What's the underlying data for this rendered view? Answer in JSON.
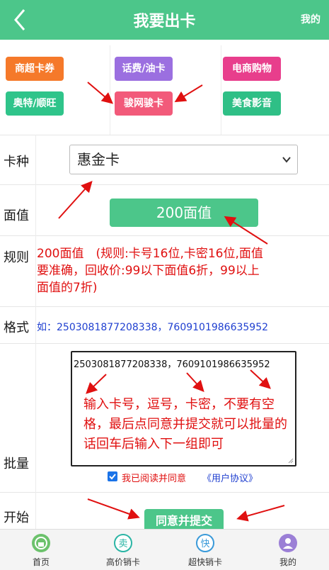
{
  "header": {
    "title": "我要出卡",
    "mine_label": "我的"
  },
  "categories": [
    {
      "label": "商超卡券",
      "color": "#f5792a"
    },
    {
      "label": "话费/油卡",
      "color": "#9b6fe0"
    },
    {
      "label": "电商购物",
      "color": "#e83e8c"
    },
    {
      "label": "奥特/顺旺",
      "color": "#2fc48a"
    },
    {
      "label": "骏网骏卡",
      "color": "#f25a7a"
    },
    {
      "label": "美食影音",
      "color": "#2fbf86"
    }
  ],
  "form": {
    "card_type_label": "卡种",
    "card_type_value": "惠金卡",
    "face_label": "面值",
    "face_value": "200面值",
    "rule_label": "规则",
    "rule_text": "200面值　(规则:卡号16位,卡密16位,面值要准确，回收价:99以下面值6折，99以上面值的7折)",
    "format_label": "格式",
    "format_text": "如：2503081877208338，7609101986635952",
    "batch_label": "批量",
    "batch_value": "2503081877208338，7609101986635952",
    "batch_hint": "输入卡号，逗号，卡密，不要有空格，最后点同意并提交就可以批量的话回车后输入下一组即可",
    "agree_text": "我已阅读并同意",
    "agree_link": "《用户协议》",
    "agree_checked": true,
    "start_label": "开始",
    "submit_label": "同意并提交"
  },
  "tabbar": [
    {
      "label": "首页",
      "icon": "home-icon",
      "color": "#6cc26c"
    },
    {
      "label": "高价销卡",
      "icon": "sell-icon",
      "color": "#2bb5a5"
    },
    {
      "label": "超快销卡",
      "icon": "fast-icon",
      "color": "#3a9ad9"
    },
    {
      "label": "我的",
      "icon": "user-icon",
      "color": "#9b7fd6"
    }
  ],
  "colors": {
    "brand": "#4cc68a",
    "annotation_red": "#e01010",
    "link_blue": "#1f3fd0"
  }
}
